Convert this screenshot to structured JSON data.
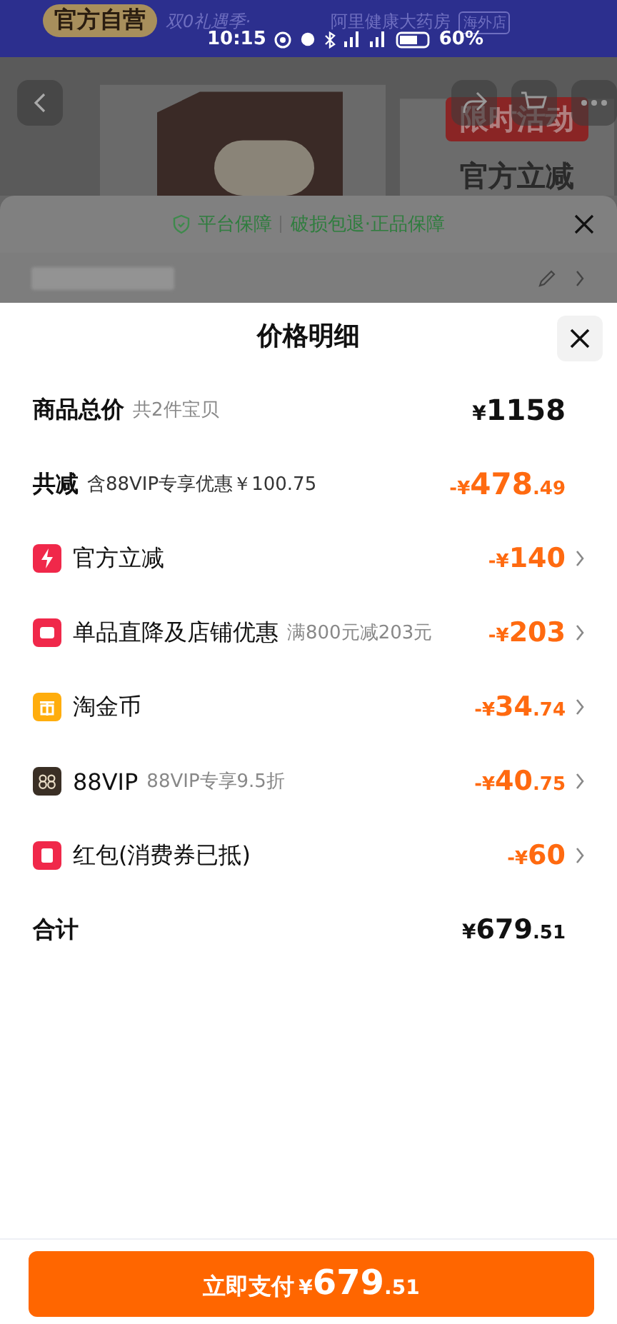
{
  "status_bar": {
    "time": "10:15",
    "battery": "60%"
  },
  "banner": {
    "badge": "官方自营",
    "slogan": "双0礼遇季·",
    "store": "阿里健康大药房",
    "tag": "海外店"
  },
  "product": {
    "promo_badge": "限时活动",
    "promo_text": "官方立减"
  },
  "guarantee": {
    "label": "平台保障",
    "detail": "破损包退·正品保障"
  },
  "sheet": {
    "title": "价格明细",
    "rows": [
      {
        "kind": "total",
        "label": "商品总价",
        "note": "共2件宝贝",
        "prefix": "¥",
        "main": "1158",
        "decimal": ""
      },
      {
        "kind": "reduction",
        "label": "共减",
        "note": "含88VIP专享优惠￥100.75",
        "prefix": "-¥",
        "main": "478",
        "decimal": ".49"
      },
      {
        "kind": "discount",
        "color": "#f0284a",
        "label": "官方立减",
        "note": "",
        "prefix": "-¥",
        "main": "140",
        "decimal": ""
      },
      {
        "kind": "discount",
        "color": "#f0284a",
        "label": "单品直降及店铺优惠",
        "note": "满800元减203元",
        "prefix": "-¥",
        "main": "203",
        "decimal": ""
      },
      {
        "kind": "discount",
        "color": "#ffad0d",
        "label": "淘金币",
        "note": "",
        "prefix": "-¥",
        "main": "34",
        "decimal": ".74"
      },
      {
        "kind": "discount",
        "color": "#3a2f25",
        "label": "88VIP",
        "note": "88VIP专享9.5折",
        "prefix": "-¥",
        "main": "40",
        "decimal": ".75"
      },
      {
        "kind": "discount",
        "color": "#f0284a",
        "label": "红包(消费券已抵)",
        "note": "",
        "prefix": "-¥",
        "main": "60",
        "decimal": ""
      },
      {
        "kind": "sum",
        "label": "合计",
        "note": "",
        "prefix": "¥",
        "main": "679",
        "decimal": ".51"
      }
    ]
  },
  "pay_button": {
    "label": "立即支付",
    "prefix": "¥",
    "main": "679",
    "decimal": ".51"
  }
}
